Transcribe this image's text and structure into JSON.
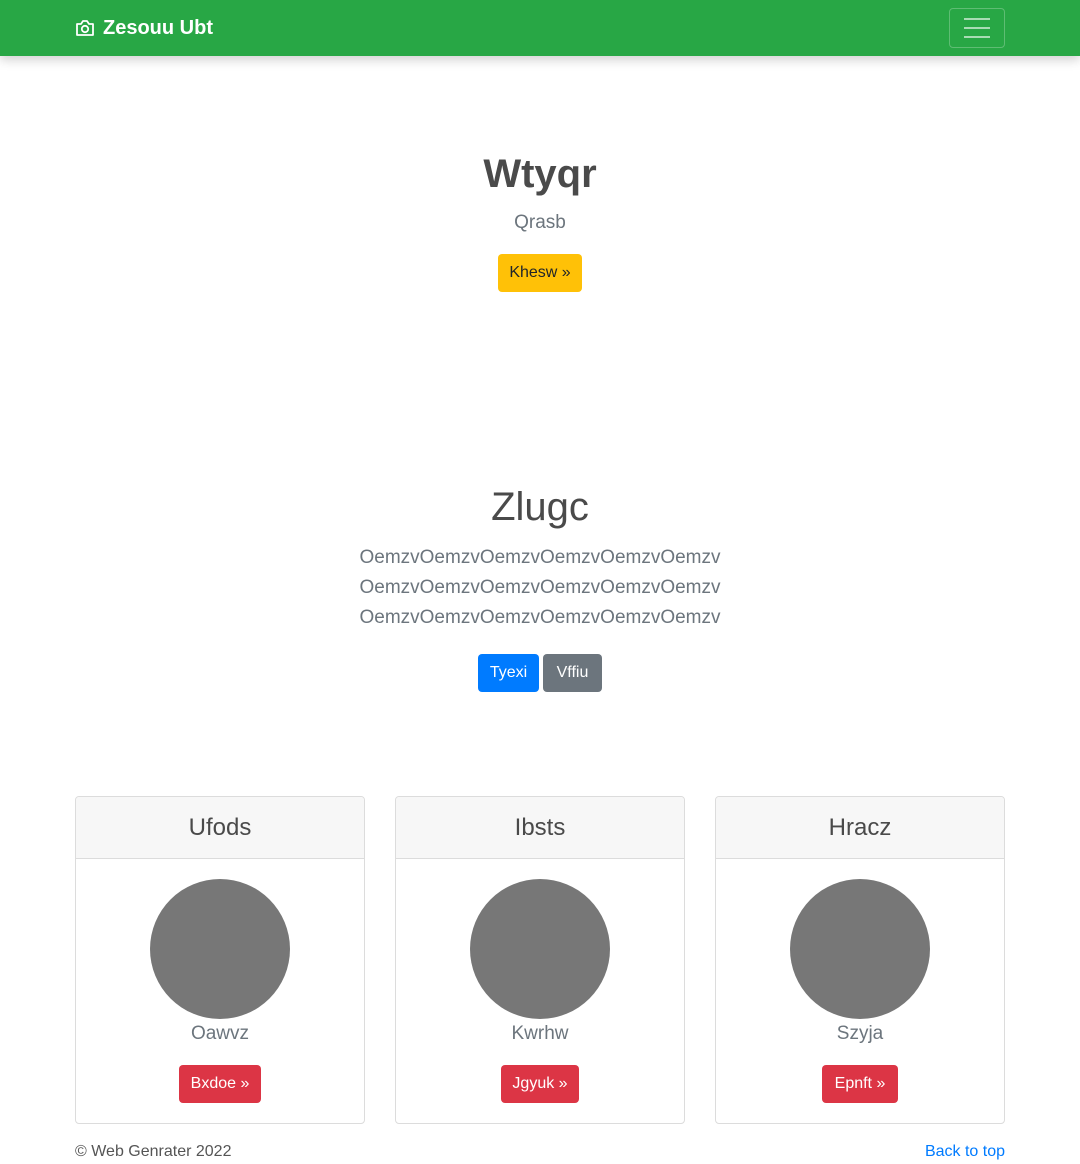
{
  "navbar": {
    "brand": "Zesouu Ubt",
    "brand_icon": "camera-icon",
    "toggler_icon": "hamburger-menu-icon",
    "color": "#28a745"
  },
  "hero": {
    "title": "Wtyqr",
    "subtitle": "Qrasb",
    "button_label": "Khesw »"
  },
  "section": {
    "title": "Zlugc",
    "lines": [
      "OemzvOemzvOemzvOemzvOemzvOemzv",
      "OemzvOemzvOemzvOemzvOemzvOemzv",
      "OemzvOemzvOemzvOemzvOemzvOemzv"
    ],
    "primary_button": "Tyexi",
    "secondary_button": "Vffiu"
  },
  "cards": [
    {
      "header": "Ufods",
      "name": "Oawvz",
      "button": "Bxdoe »"
    },
    {
      "header": "Ibsts",
      "name": "Kwrhw",
      "button": "Jgyuk »"
    },
    {
      "header": "Hracz",
      "name": "Szyja",
      "button": "Epnft »"
    }
  ],
  "footer": {
    "copyright": "© Web Genrater 2022",
    "back_to_top": "Back to top"
  },
  "colors": {
    "warning": "#ffc107",
    "primary": "#007bff",
    "secondary": "#6c757d",
    "danger": "#dc3545",
    "placeholder": "#777777"
  }
}
